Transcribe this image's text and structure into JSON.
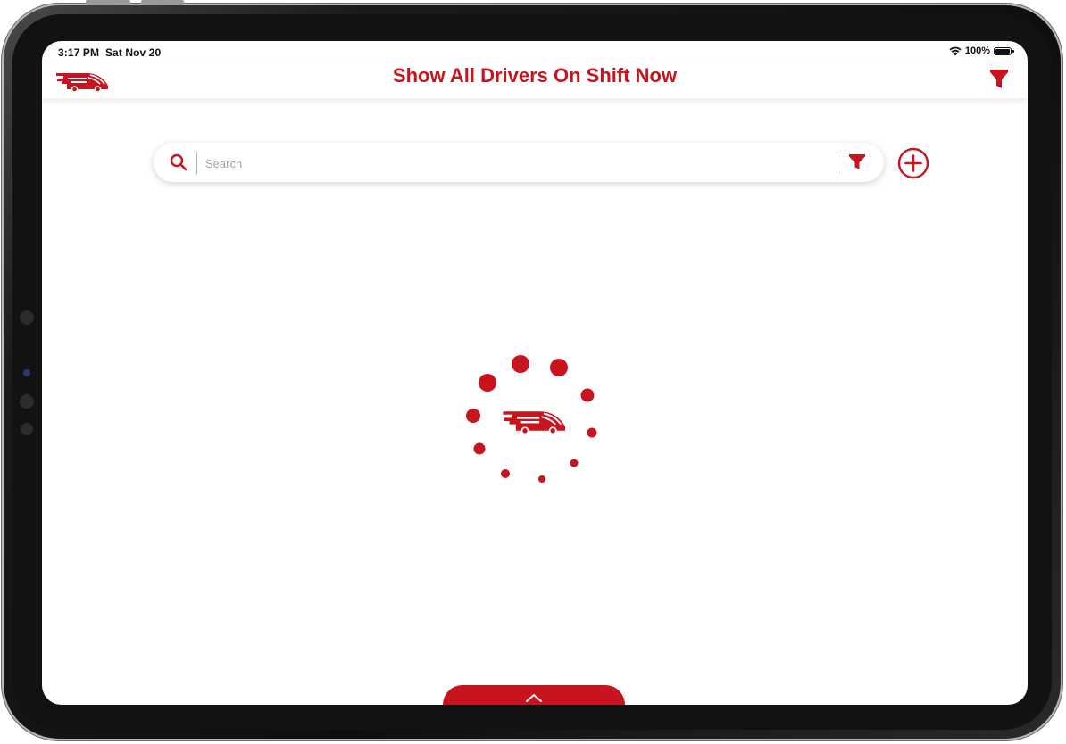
{
  "status_bar": {
    "time": "3:17 PM",
    "date": "Sat Nov 20",
    "battery": "100%",
    "wifi_icon": "wifi-icon",
    "battery_icon": "battery-icon"
  },
  "header": {
    "title": "Show All Drivers On Shift Now",
    "logo_icon": "truck-logo-icon",
    "filter_icon": "filter-icon"
  },
  "search": {
    "placeholder": "Search",
    "value": "",
    "search_icon": "search-icon",
    "filter_icon": "filter-icon"
  },
  "add_button": {
    "icon": "plus-circle-icon"
  },
  "loader": {
    "icon": "truck-logo-icon"
  },
  "bottom_tab": {
    "icon": "chevron-up-icon"
  },
  "colors": {
    "brand_red": "#c8141e",
    "background": "#ffffff",
    "text_dark": "#111111",
    "placeholder_gray": "#a3a3a3"
  }
}
